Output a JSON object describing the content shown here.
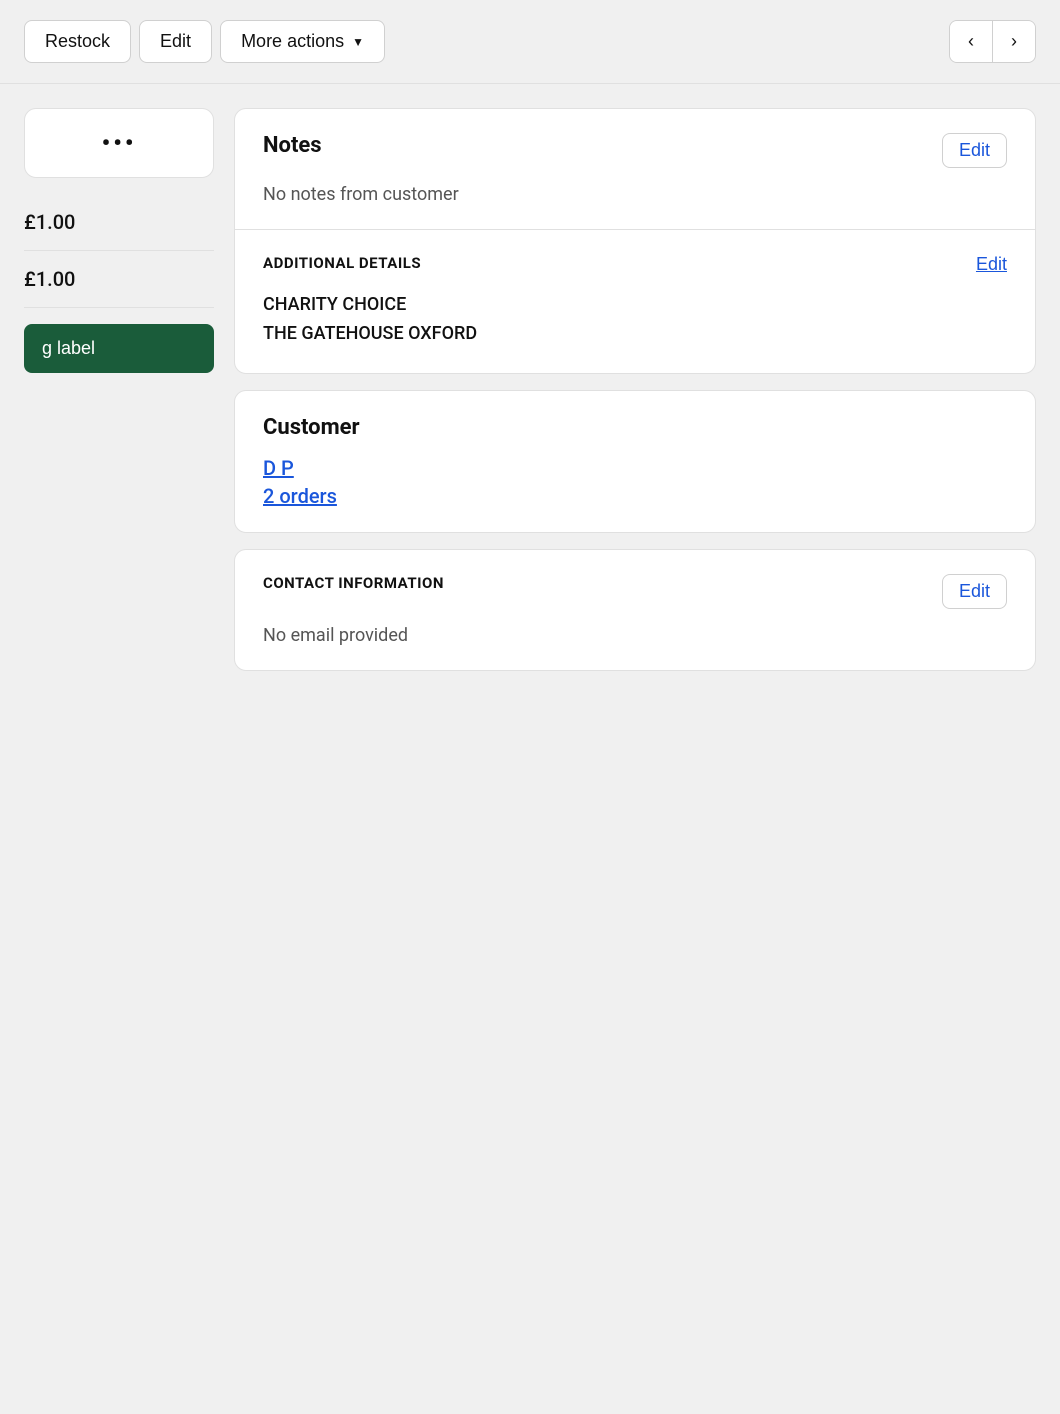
{
  "topbar": {
    "restock_label": "Restock",
    "edit_label": "Edit",
    "more_actions_label": "More actions",
    "prev_label": "‹",
    "next_label": "›"
  },
  "left_column": {
    "ellipsis": "•••",
    "price1": "£1.00",
    "price2": "£1.00",
    "green_btn_label": "g label"
  },
  "notes_card": {
    "title": "Notes",
    "edit_label": "Edit",
    "empty_text": "No notes from customer"
  },
  "additional_details_card": {
    "title": "ADDITIONAL DETAILS",
    "edit_label": "Edit",
    "line1": "CHARITY CHOICE",
    "line2": "THE GATEHOUSE OXFORD"
  },
  "customer_card": {
    "title": "Customer",
    "customer_name": "D P",
    "orders_text": "2 orders"
  },
  "contact_card": {
    "title": "CONTACT INFORMATION",
    "edit_label": "Edit",
    "no_email_text": "No email provided"
  }
}
